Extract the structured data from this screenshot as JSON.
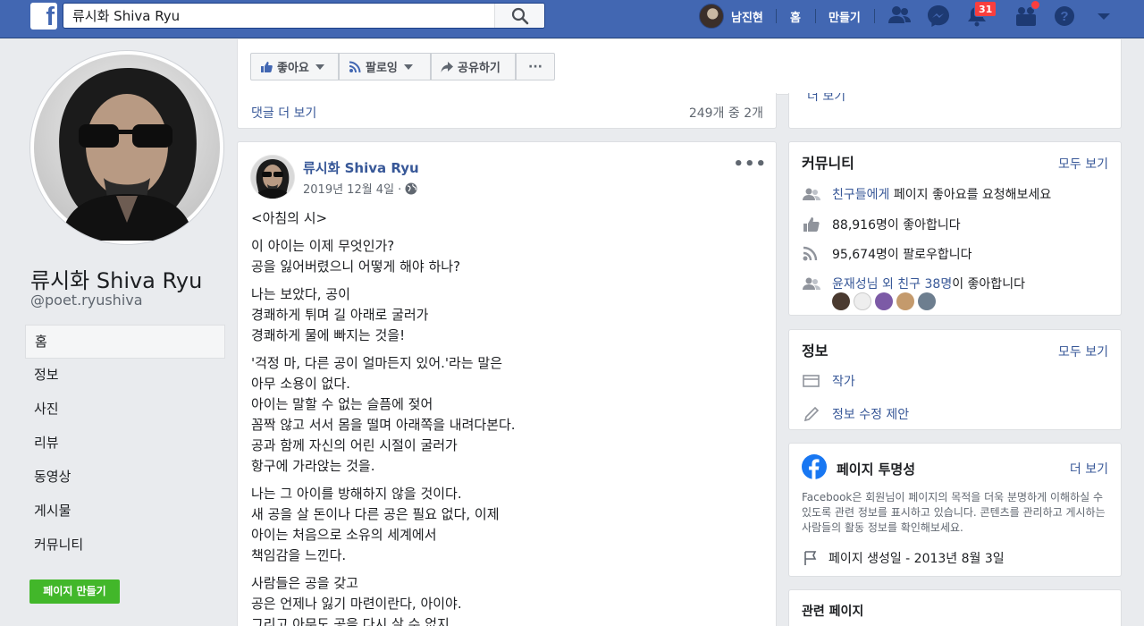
{
  "topbar": {
    "search_value": "류시화 Shiva Ryu",
    "user_name": "남진현",
    "home_label": "홈",
    "create_label": "만들기",
    "notification_count": "31"
  },
  "profile": {
    "name": "류시화 Shiva Ryu",
    "handle": "@poet.ryushiva"
  },
  "left_nav": {
    "items": [
      "홈",
      "정보",
      "사진",
      "리뷰",
      "동영상",
      "게시물",
      "커뮤니티"
    ],
    "active_index": 0,
    "create_page_label": "페이지 만들기"
  },
  "action_bar": {
    "like_label": "좋아요",
    "follow_label": "팔로잉",
    "share_label": "공유하기",
    "more_label": "···"
  },
  "comments": {
    "more_label": "댓글 더 보기",
    "count_label": "249개 중 2개"
  },
  "post": {
    "author": "류시화 Shiva Ryu",
    "date": "2019년 12월 4일 ·",
    "menu": "•••",
    "paragraphs": [
      "<아침의 시>",
      "이 아이는 이제 무엇인가?\n공을 잃어버렸으니 어떻게 해야 하나?",
      "나는 보았다, 공이\n경쾌하게 튀며 길 아래로 굴러가\n경쾌하게 물에 빠지는 것을!",
      "'걱정 마, 다른 공이 얼마든지 있어.'라는 말은\n아무 소용이 없다.\n아이는 말할 수 없는 슬픔에 젖어\n꼼짝 않고 서서 몸을 떨며 아래쪽을 내려다본다.\n공과 함께 자신의 어린 시절이 굴러가\n항구에 가라앉는 것을.",
      "나는 그 아이를 방해하지 않을 것이다.\n새 공을 살 돈이나 다른 공은 필요 없다, 이제\n아이는 처음으로 소유의 세계에서\n책임감을 느낀다.",
      "사람들은 공을 갖고\n공은 언제나 잃기 마련이란다, 아이야.\n그리고 아무도 공을 다시 살 수 없지."
    ]
  },
  "right": {
    "top_more": "더 보기",
    "community": {
      "title": "커뮤니티",
      "see_all": "모두 보기",
      "invite_link": "친구들에게",
      "invite_rest": " 페이지 좋아요를 요청해보세요",
      "likes": "88,916명이 좋아합니다",
      "follows": "95,674명이 팔로우합니다",
      "friends_link": "윤재성님 외 친구 38명",
      "friends_rest": "이 좋아합니다"
    },
    "info": {
      "title": "정보",
      "see_all": "모두 보기",
      "category": "작가",
      "suggest_edit": "정보 수정 제안"
    },
    "transparency": {
      "title": "페이지 투명성",
      "see_more": "더 보기",
      "description": "Facebook은 회원님이 페이지의 목적을 더욱 분명하게 이해하실 수 있도록 관련 정보를 표시하고 있습니다. 콘텐츠를 관리하고 게시하는 사람들의 활동 정보를 확인해보세요.",
      "created": "페이지 생성일 - 2013년 8월 3일"
    },
    "related": {
      "title": "관련 페이지"
    }
  },
  "colors": {
    "brand_blue": "#4267b2",
    "link_blue": "#385898",
    "create_green": "#42b72a",
    "badge_red": "#fa3e3e"
  }
}
